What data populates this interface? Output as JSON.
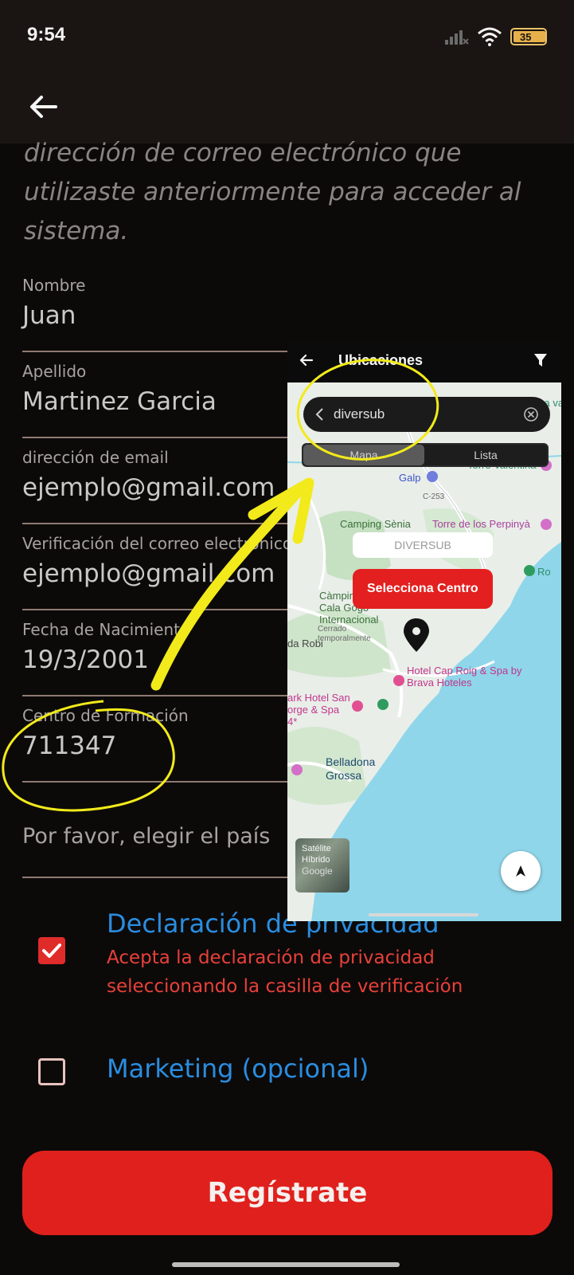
{
  "status_bar": {
    "time": "9:54",
    "battery": "35",
    "battery_level": 0.35
  },
  "intro_text": "dirección de correo electrónico que utilizaste anteriormente para acceder al sistema.",
  "fields": [
    {
      "label": "Nombre",
      "value": "Juan"
    },
    {
      "label": "Apellido",
      "value": "Martinez Garcia"
    },
    {
      "label": "dirección de email",
      "value": "ejemplo@gmail.com"
    },
    {
      "label": "Verificación del correo electrónico",
      "value": "ejemplo@gmail.com"
    },
    {
      "label": "Fecha de Nacimiento",
      "value": "19/3/2001"
    },
    {
      "label": "Centro de Formación",
      "value": "711347"
    }
  ],
  "country_placeholder": "Por favor, elegir el país",
  "privacy": {
    "title": "Declaración de privacidad",
    "description": "Acepta la declaración de privacidad seleccionando la casilla de verificación",
    "checked": true
  },
  "marketing": {
    "title": "Marketing (opcional)",
    "checked": false
  },
  "register_label": "Regístrate",
  "overlay": {
    "title": "Ubicaciones",
    "search_value": "diversub",
    "tabs": [
      "Mapa",
      "Lista"
    ],
    "active_tab": "Mapa",
    "center_name": "DIVERSUB",
    "select_button": "Selecciona Centro",
    "map_type": [
      "Satélite",
      "Híbrido"
    ],
    "map_labels": {
      "torre_valentina": "Torre Valentina",
      "galp": "Galp",
      "c253": "C-253",
      "camping_senia": "Camping Sènia",
      "torre_perpinya": "Torre de los Perpinyà",
      "camping_cala_gogo": "Càmping Cala Gogo Internacional",
      "cerrado": "Cerrado temporalmente",
      "hotel_cap_roig": "Hotel Cap Roig & Spa by Brava Hoteles",
      "park_hotel": "ark Hotel San orge & Spa 4*",
      "belladona": "Belladona Grossa",
      "google": "Google",
      "ro": "Ro",
      "va": "ya vale",
      "da_robi": "da Robi"
    }
  },
  "colors": {
    "background": "#0c0a09",
    "header": "#1a1512",
    "accent_red": "#e0201c",
    "link_blue": "#2a8de0",
    "error_red": "#e8403a",
    "annotation_yellow": "#f2ea1a"
  },
  "icons": [
    "back-arrow-icon",
    "signal-icon",
    "wifi-icon",
    "battery-icon",
    "checkmark-icon",
    "filter-icon",
    "chevron-left-icon",
    "clear-icon",
    "location-pin-icon",
    "compass-icon"
  ]
}
